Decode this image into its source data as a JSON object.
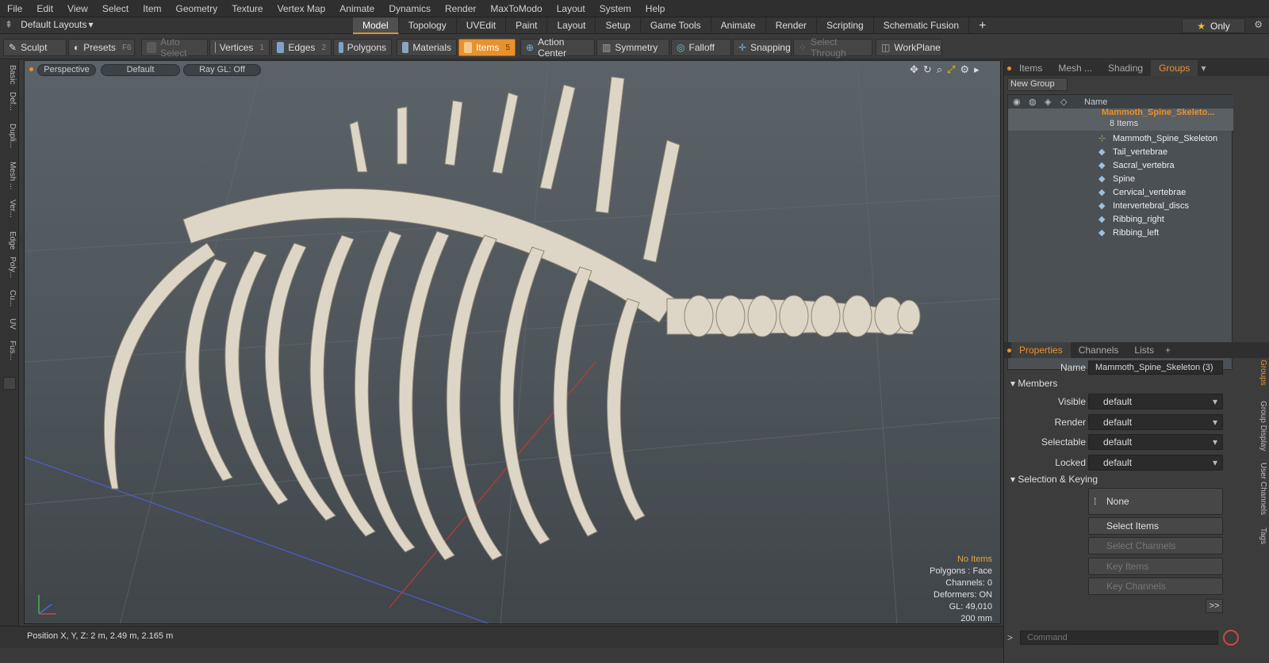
{
  "menu": [
    "File",
    "Edit",
    "View",
    "Select",
    "Item",
    "Geometry",
    "Texture",
    "Vertex Map",
    "Animate",
    "Dynamics",
    "Render",
    "MaxToModo",
    "Layout",
    "System",
    "Help"
  ],
  "layout": {
    "selector": "Default Layouts",
    "tabs": [
      "Model",
      "Topology",
      "UVEdit",
      "Paint",
      "Layout",
      "Setup",
      "Game Tools",
      "Animate",
      "Render",
      "Scripting",
      "Schematic Fusion"
    ],
    "only": "Only"
  },
  "toolbar": {
    "sculpt": "Sculpt",
    "presets": "Presets",
    "presets_key": "F6",
    "auto_select": "Auto Select",
    "vertices": "Vertices",
    "vertices_key": "1",
    "edges": "Edges",
    "edges_key": "2",
    "polygons": "Polygons",
    "materials": "Materials",
    "items": "Items",
    "items_key": "5",
    "action_center": "Action Center",
    "symmetry": "Symmetry",
    "falloff": "Falloff",
    "snapping": "Snapping",
    "select_through": "Select Through",
    "workplane": "WorkPlane"
  },
  "left_tabs": [
    "Basic",
    "Def...",
    "Dupli...",
    "Mesh ...",
    "Ver...",
    "Edge",
    "Poly...",
    "Cu...",
    "UV",
    "Fus..."
  ],
  "viewport": {
    "view": "Perspective",
    "shading": "Default",
    "raygl": "Ray GL: Off",
    "hud": {
      "no_items": "No Items",
      "polygons": "Polygons : Face",
      "channels": "Channels: 0",
      "deformers": "Deformers: ON",
      "gl": "GL: 49,010",
      "scale": "200 mm"
    }
  },
  "status": {
    "position": "Position X, Y, Z:   2 m, 2.49 m, 2.165 m"
  },
  "groups_panel": {
    "tabs": [
      "Items",
      "Mesh ...",
      "Shading",
      "Groups"
    ],
    "new_group": "New Group",
    "col_name": "Name",
    "group_name": "Mammoth_Spine_Skeleto...",
    "group_count": "8 Items",
    "items": [
      "Mammoth_Spine_Skeleton",
      "Tail_vertebrae",
      "Sacral_vertebra",
      "Spine",
      "Cervical_vertebrae",
      "Intervertebral_discs",
      "Ribbing_right",
      "Ribbing_left"
    ]
  },
  "properties_panel": {
    "tabs": [
      "Properties",
      "Channels",
      "Lists"
    ],
    "name_label": "Name",
    "name_value": "Mammoth_Spine_Skeleton (3)",
    "members": "Members",
    "visible_label": "Visible",
    "render_label": "Render",
    "selectable_label": "Selectable",
    "locked_label": "Locked",
    "dd_default": "default",
    "sel_keying": "Selection & Keying",
    "none": "None",
    "select_items": "Select Items",
    "select_channels": "Select Channels",
    "key_items": "Key Items",
    "key_channels": "Key Channels",
    "side_tabs": [
      "Groups",
      "Group Display",
      "User Channels",
      "Tags"
    ]
  },
  "command": {
    "placeholder": "Command"
  },
  "colors": {
    "accent": "#e8922c",
    "bone": "#ddd6c7"
  }
}
